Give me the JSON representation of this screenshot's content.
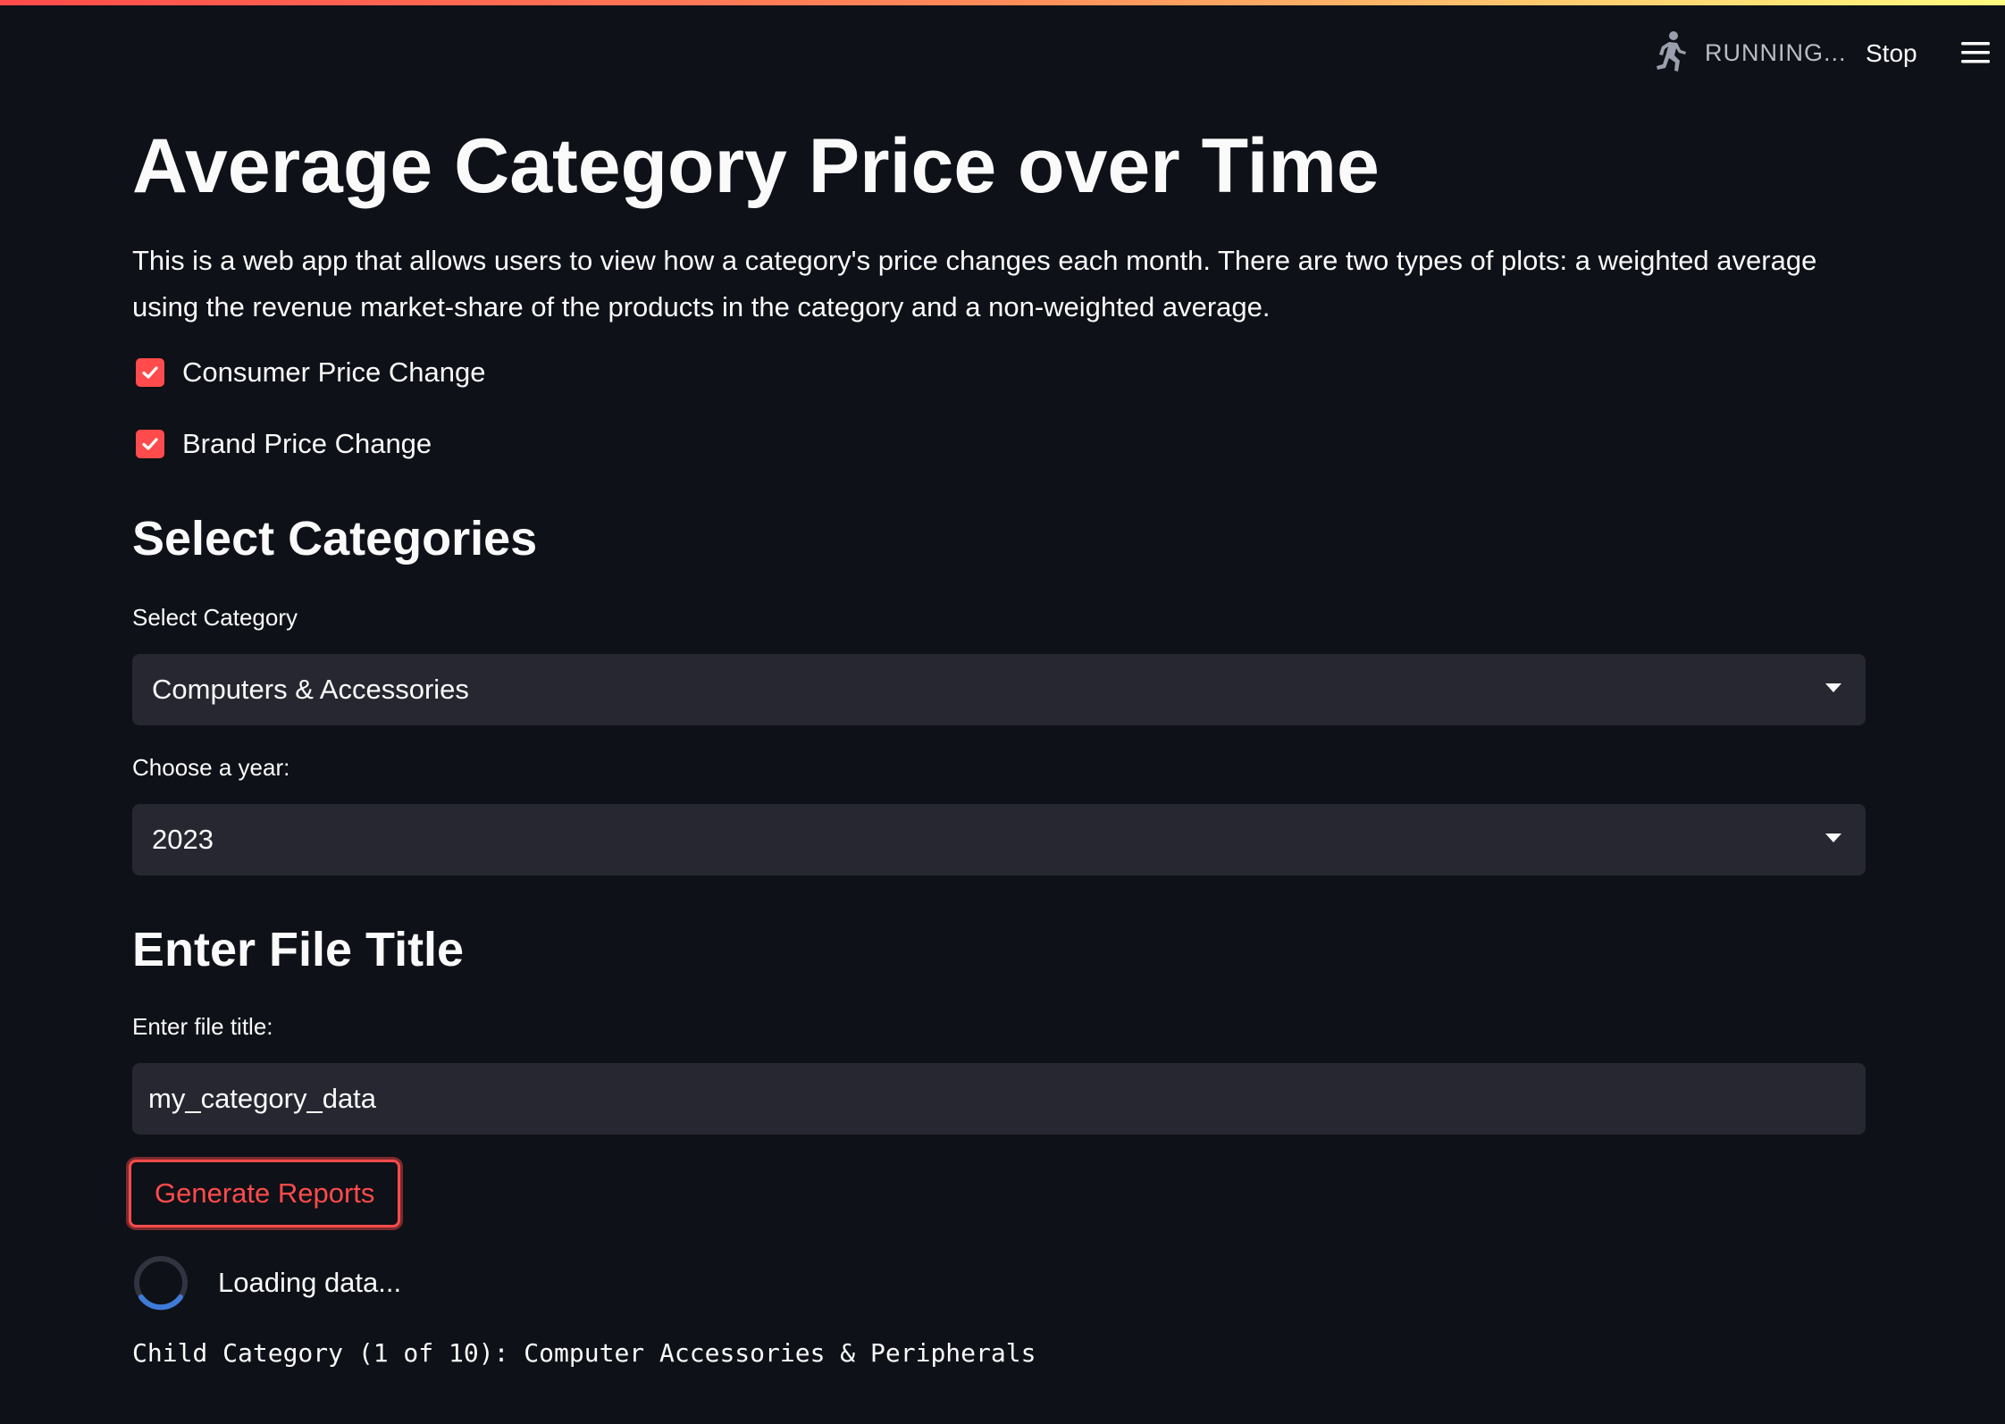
{
  "header": {
    "status_text": "RUNNING...",
    "stop_label": "Stop",
    "status_icon": "running-man-icon",
    "menu_icon": "hamburger-menu-icon"
  },
  "main": {
    "title": "Average Category Price over Time",
    "intro": "This is a web app that allows users to view how a category's price changes each month. There are two types of plots: a weighted average using the revenue market-share of the products in the category and a non-weighted average.",
    "checkboxes": [
      {
        "label": "Consumer Price Change",
        "checked": true
      },
      {
        "label": "Brand Price Change",
        "checked": true
      }
    ],
    "select_categories": {
      "heading": "Select Categories",
      "category_label": "Select Category",
      "category_value": "Computers & Accessories",
      "year_label": "Choose a year:",
      "year_value": "2023"
    },
    "file_title": {
      "heading": "Enter File Title",
      "label": "Enter file title:",
      "value": "my_category_data"
    },
    "generate_button": "Generate Reports",
    "loading_text": "Loading data...",
    "child_category": "Child Category (1 of 10): Computer Accessories & Peripherals"
  },
  "colors": {
    "background": "#0e1117",
    "accent": "#ff4b4b",
    "input_bg": "#262730",
    "spinner": "#3d7bd9"
  }
}
